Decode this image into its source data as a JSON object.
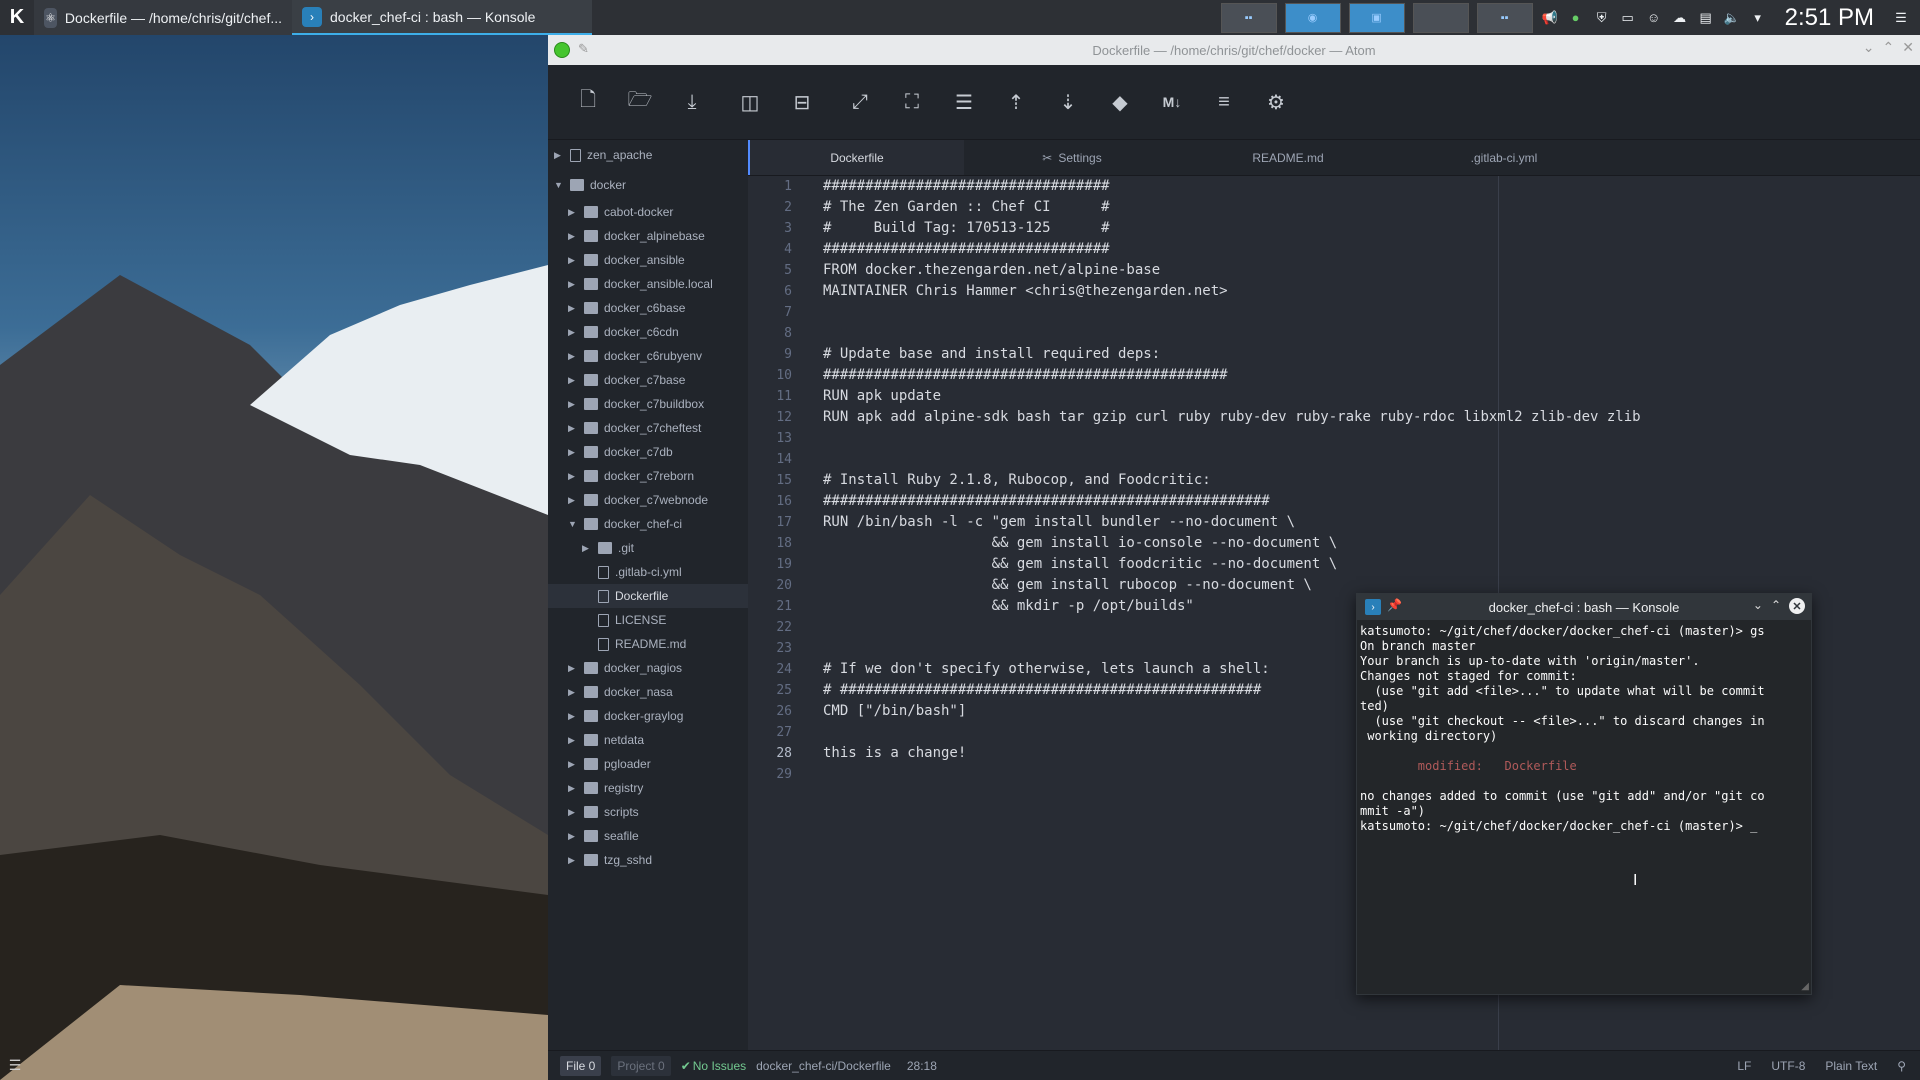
{
  "taskbar": {
    "tasks": [
      {
        "label": "Dockerfile — /home/chris/git/chef..."
      },
      {
        "label": "docker_chef-ci : bash — Konsole"
      }
    ],
    "clock": "2:51 PM"
  },
  "atom": {
    "title": "Dockerfile — /home/chris/git/chef/docker — Atom",
    "toolbar": [
      "new-file-icon",
      "open-folder-icon",
      "save-icon",
      "split-vertical-icon",
      "split-horizontal-icon",
      "fullscreen-icon",
      "tree-icon",
      "indent-icon",
      "upload-icon",
      "download-icon",
      "git-icon",
      "markdown-icon",
      "menu-icon",
      "settings-icon"
    ],
    "tree": {
      "root": "zen_apache",
      "docker": "docker",
      "items": [
        {
          "label": "cabot-docker",
          "type": "folder",
          "depth": 2
        },
        {
          "label": "docker_alpinebase",
          "type": "folder",
          "depth": 2
        },
        {
          "label": "docker_ansible",
          "type": "folder",
          "depth": 2
        },
        {
          "label": "docker_ansible.local",
          "type": "folder",
          "depth": 2
        },
        {
          "label": "docker_c6base",
          "type": "folder",
          "depth": 2
        },
        {
          "label": "docker_c6cdn",
          "type": "folder",
          "depth": 2
        },
        {
          "label": "docker_c6rubyenv",
          "type": "folder",
          "depth": 2
        },
        {
          "label": "docker_c7base",
          "type": "folder",
          "depth": 2
        },
        {
          "label": "docker_c7buildbox",
          "type": "folder",
          "depth": 2
        },
        {
          "label": "docker_c7cheftest",
          "type": "folder",
          "depth": 2
        },
        {
          "label": "docker_c7db",
          "type": "folder",
          "depth": 2
        },
        {
          "label": "docker_c7reborn",
          "type": "folder",
          "depth": 2
        },
        {
          "label": "docker_c7webnode",
          "type": "folder",
          "depth": 2
        },
        {
          "label": "docker_chef-ci",
          "type": "folder-open",
          "depth": 2
        },
        {
          "label": ".git",
          "type": "folder",
          "depth": 3
        },
        {
          "label": ".gitlab-ci.yml",
          "type": "file",
          "depth": 3
        },
        {
          "label": "Dockerfile",
          "type": "file",
          "depth": 3,
          "selected": true
        },
        {
          "label": "LICENSE",
          "type": "file",
          "depth": 3
        },
        {
          "label": "README.md",
          "type": "file",
          "depth": 3
        },
        {
          "label": "docker_nagios",
          "type": "folder",
          "depth": 2
        },
        {
          "label": "docker_nasa",
          "type": "folder",
          "depth": 2
        },
        {
          "label": "docker-graylog",
          "type": "folder",
          "depth": 2
        },
        {
          "label": "netdata",
          "type": "folder",
          "depth": 2
        },
        {
          "label": "pgloader",
          "type": "folder",
          "depth": 2
        },
        {
          "label": "registry",
          "type": "folder",
          "depth": 2
        },
        {
          "label": "scripts",
          "type": "folder",
          "depth": 2
        },
        {
          "label": "seafile",
          "type": "folder",
          "depth": 2
        },
        {
          "label": "tzg_sshd",
          "type": "folder",
          "depth": 2
        }
      ]
    },
    "tabs": [
      {
        "label": "Dockerfile",
        "active": true
      },
      {
        "label": "Settings"
      },
      {
        "label": "README.md"
      },
      {
        "label": ".gitlab-ci.yml"
      }
    ],
    "code": [
      "##################################",
      "# The Zen Garden :: Chef CI      #",
      "#     Build Tag: 170513-125      #",
      "##################################",
      "FROM docker.thezengarden.net/alpine-base",
      "MAINTAINER Chris Hammer <chris@thezengarden.net>",
      "",
      "",
      "# Update base and install required deps:",
      "################################################",
      "RUN apk update",
      "RUN apk add alpine-sdk bash tar gzip curl ruby ruby-dev ruby-rake ruby-rdoc libxml2 zlib-dev zlib",
      "",
      "",
      "# Install Ruby 2.1.8, Rubocop, and Foodcritic:",
      "#####################################################",
      "RUN /bin/bash -l -c \"gem install bundler --no-document \\",
      "                    && gem install io-console --no-document \\",
      "                    && gem install foodcritic --no-document \\",
      "                    && gem install rubocop --no-document \\",
      "                    && mkdir -p /opt/builds\"",
      "",
      "",
      "# If we don't specify otherwise, lets launch a shell:",
      "# ##################################################",
      "CMD [\"/bin/bash\"]",
      "",
      "this is a change!",
      ""
    ],
    "current_line": 28,
    "status": {
      "file_count": "File 0",
      "project_count": "Project 0",
      "issues": "No Issues",
      "path": "docker_chef-ci/Dockerfile",
      "cursor": "28:18",
      "line_ending": "LF",
      "encoding": "UTF-8",
      "grammar": "Plain Text"
    }
  },
  "konsole": {
    "title": "docker_chef-ci : bash — Konsole",
    "lines": [
      "katsumoto: ~/git/chef/docker/docker_chef-ci (master)> gs",
      "On branch master",
      "Your branch is up-to-date with 'origin/master'.",
      "Changes not staged for commit:",
      "  (use \"git add <file>...\" to update what will be commit",
      "ted)",
      "  (use \"git checkout -- <file>...\" to discard changes in",
      " working directory)",
      "",
      "        modified:   Dockerfile",
      "",
      "no changes added to commit (use \"git add\" and/or \"git co",
      "mmit -a\")",
      "katsumoto: ~/git/chef/docker/docker_chef-ci (master)> _"
    ]
  }
}
